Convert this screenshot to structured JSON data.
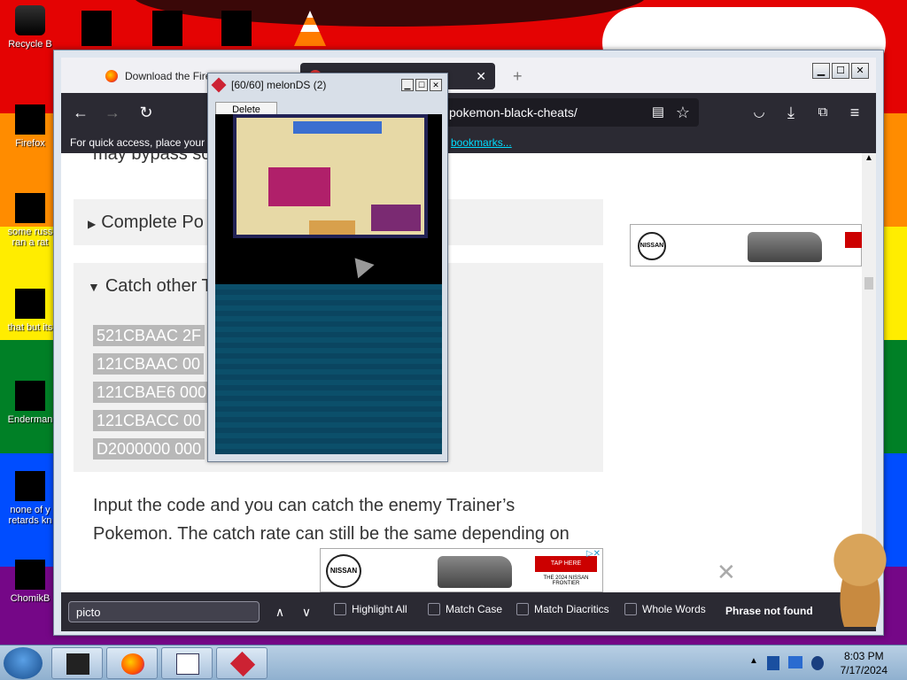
{
  "desktop": {
    "icons": [
      {
        "label": "Recycle B",
        "icon": "recycle-bin-icon"
      },
      {
        "label": "Firefox",
        "icon": "firefox-icon"
      },
      {
        "label": "some russ ran a rat",
        "icon": "file-icon"
      },
      {
        "label": "that but its",
        "icon": "folder-icon"
      },
      {
        "label": "Enderman",
        "icon": "file-icon"
      },
      {
        "label": "none of y retards kn",
        "icon": "file-icon"
      },
      {
        "label": "ChomikB",
        "icon": "hamster-icon"
      }
    ]
  },
  "firefox": {
    "tabs": [
      {
        "label": "Download the Fire",
        "active": false
      },
      {
        "label": "",
        "active": true
      }
    ],
    "url": "pokemon-black-cheats/",
    "bookmarks_hint": "For quick access, place your b",
    "bookmarks_link": "bookmarks...",
    "content": {
      "top_fragment": "may bypass so",
      "accordion_1": "Complete Po",
      "accordion_2": "Catch other T",
      "codes": [
        "521CBAAC 2F",
        "121CBAAC 00",
        "121CBAE6 000",
        "121CBACC 00",
        "D2000000 000"
      ],
      "paragraph": "Input the code and you can catch the enemy Trainer’s Pokemon. The catch rate can still be the same depending on",
      "ad_brand": "NISSAN",
      "ad_cta": "TAP HERE",
      "ad_tagline": "THE 2024 NISSAN FRONTIER"
    },
    "findbar": {
      "query": "picto",
      "highlight_all": "Highlight All",
      "match_case": "Match Case",
      "match_diacritics": "Match Diacritics",
      "whole_words": "Whole Words",
      "status": "Phrase not found"
    }
  },
  "melonds": {
    "title": "[60/60] melonDS (2)",
    "menu": "Delete"
  },
  "taskbar": {
    "time": "8:03 PM",
    "date": "7/17/2024"
  }
}
